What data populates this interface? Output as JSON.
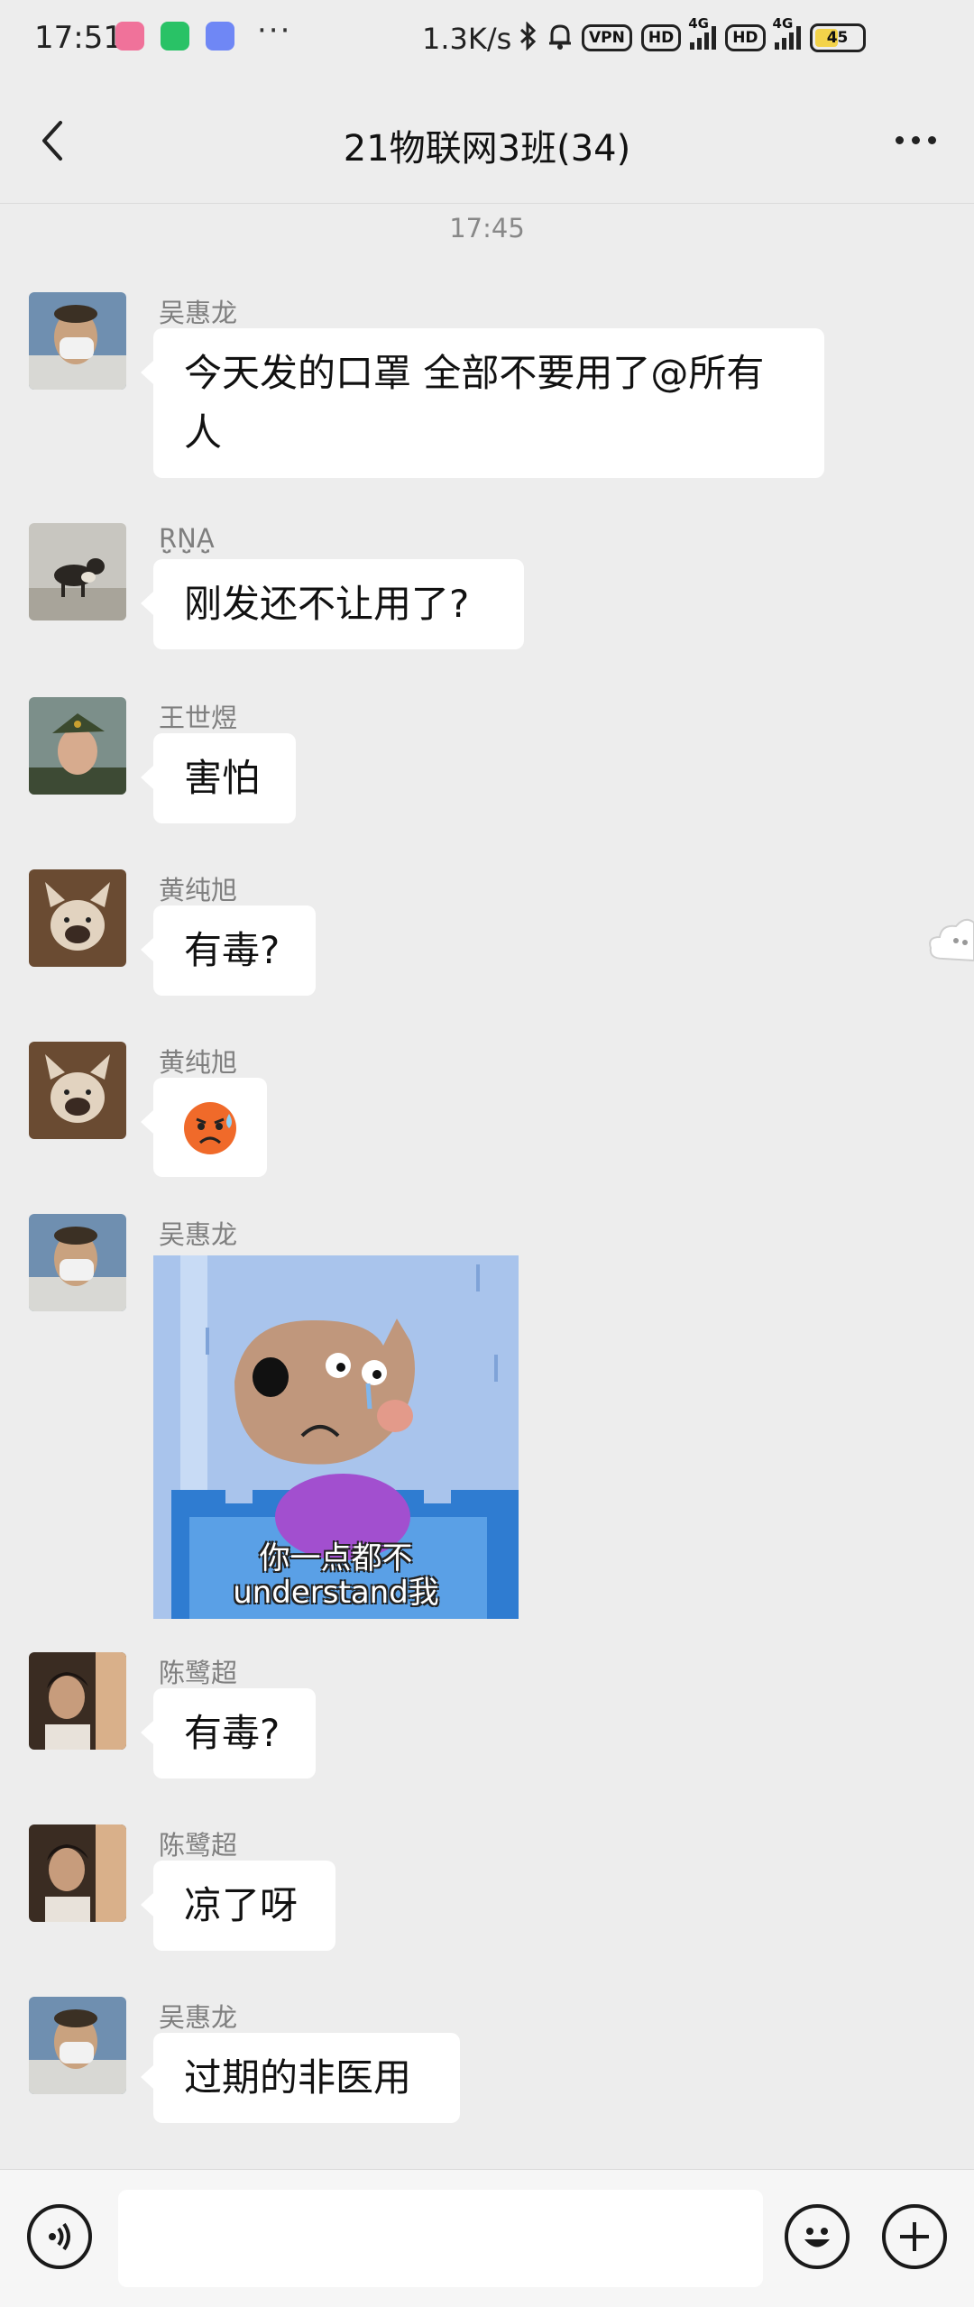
{
  "status_bar": {
    "time": "17:51",
    "net_speed": "1.3K/s",
    "vpn": "VPN",
    "hd1": "HD",
    "hd2": "HD",
    "net1": "4G",
    "net2": "4G",
    "battery": "45",
    "apps": [
      {
        "name": "bilibili-icon",
        "color": "#f0729a"
      },
      {
        "name": "wechat-icon",
        "color": "#29c266"
      },
      {
        "name": "qq-icon",
        "color": "#6f87f5"
      }
    ]
  },
  "header": {
    "title": "21物联网3班(34)"
  },
  "time_separator": "17:45",
  "messages": [
    {
      "sender": "吴惠龙",
      "text": "今天发的口罩 全部不要用了@所有人"
    },
    {
      "sender": "R̤̮N̤̮A̤̮",
      "text": "刚发还不让用了?"
    },
    {
      "sender": "王世煜",
      "text": "害怕"
    },
    {
      "sender": "黄纯旭",
      "text": "有毒?"
    },
    {
      "sender": "黄纯旭",
      "emoji": "cold-sweat-emoji"
    },
    {
      "sender": "吴惠龙",
      "sticker_caption": "你一点都不\nunderstand我"
    },
    {
      "sender": "陈鹭超",
      "text": "有毒?"
    },
    {
      "sender": "陈鹭超",
      "text": "凉了呀"
    },
    {
      "sender": "吴惠龙",
      "text": "过期的非医用"
    }
  ],
  "input_bar": {
    "voice": "voice-icon",
    "emoji": "emoji-icon",
    "plus": "plus-icon"
  }
}
